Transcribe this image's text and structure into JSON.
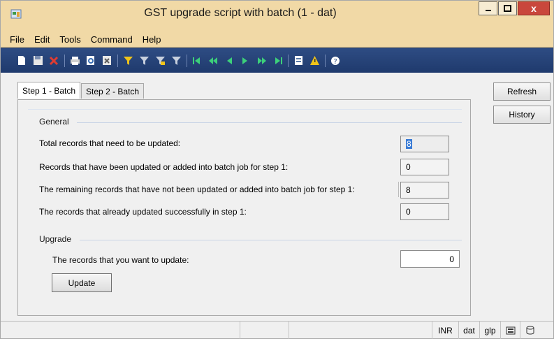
{
  "window": {
    "title": "GST upgrade script with batch (1 - dat)",
    "close_glyph": "x"
  },
  "menu": {
    "file": "File",
    "edit": "Edit",
    "tools": "Tools",
    "command": "Command",
    "help": "Help"
  },
  "toolbar": {
    "icons": [
      "new-icon",
      "save-icon",
      "delete-icon",
      "print-icon",
      "print-preview-icon",
      "export-icon",
      "filter-by-selection-icon",
      "filter-by-grid-icon",
      "advanced-filter-icon",
      "remove-filter-icon",
      "first-record-icon",
      "previous-page-icon",
      "previous-record-icon",
      "next-record-icon",
      "next-page-icon",
      "last-record-icon",
      "document-handling-icon",
      "alert-icon",
      "help-icon"
    ]
  },
  "tabs": [
    {
      "label": "Step 1 - Batch",
      "active": true
    },
    {
      "label": "Step 2 - Batch",
      "active": false
    }
  ],
  "general": {
    "heading": "General",
    "rows": [
      {
        "label": "Total records that need to be updated:",
        "value": "8"
      },
      {
        "label": "Records that have been updated or added into batch job for step 1:",
        "value": "0"
      },
      {
        "label": "The remaining records that have not been updated or added into batch job for step 1:",
        "value": "8"
      },
      {
        "label": "The records that already updated successfully in step 1:",
        "value": "0"
      }
    ]
  },
  "upgrade": {
    "heading": "Upgrade",
    "label": "The records that you want to update:",
    "value": "0",
    "button": "Update"
  },
  "side_buttons": {
    "refresh": "Refresh",
    "history": "History"
  },
  "status": {
    "currency": "INR",
    "company": "dat",
    "layer": "glp"
  },
  "colors": {
    "titlebar": "#f1d9a6",
    "toolbar": "#1f3a6d",
    "close": "#c9473c"
  }
}
